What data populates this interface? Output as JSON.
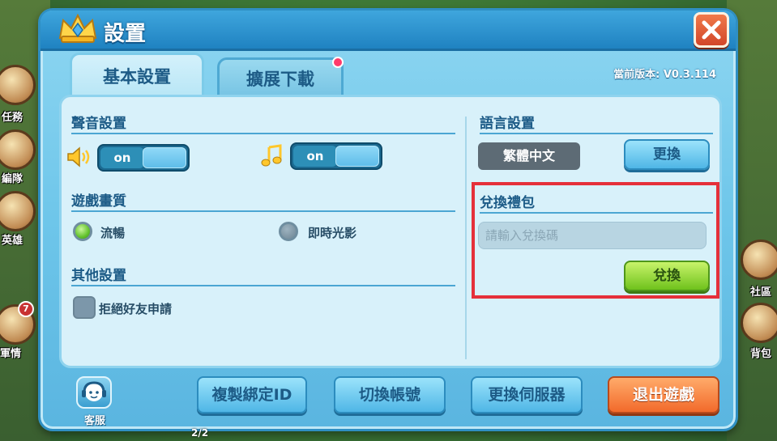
{
  "dialog": {
    "title": "設置",
    "tabs": [
      {
        "label": "基本設置",
        "active": true
      },
      {
        "label": "擴展下載",
        "active": false,
        "has_notification": true
      }
    ],
    "version_label": "當前版本: V0.3.114"
  },
  "sound": {
    "title": "聲音設置",
    "sound_effects": {
      "icon": "speaker-icon",
      "toggle_label": "on"
    },
    "music": {
      "icon": "music-note-icon",
      "toggle_label": "on"
    }
  },
  "quality": {
    "title": "遊戲畫質",
    "options": [
      {
        "label": "流暢",
        "selected": true
      },
      {
        "label": "即時光影",
        "selected": false
      }
    ]
  },
  "other": {
    "title": "其他設置",
    "reject_friend_label": "拒絕好友申請"
  },
  "language": {
    "title": "語言設置",
    "current": "繁體中文",
    "change_button": "更換"
  },
  "gift": {
    "title": "兌換禮包",
    "placeholder": "請輸入兌換碼",
    "redeem_button": "兌換"
  },
  "footer": {
    "support_label": "客服",
    "buttons": [
      "複製綁定ID",
      "切換帳號",
      "更換伺服器",
      "退出遊戲"
    ],
    "page_indicator": "2/2"
  },
  "background": {
    "left_labels": [
      "任務",
      "編隊",
      "英雄",
      "軍情"
    ],
    "right_labels": [
      "社區",
      "背包"
    ],
    "badge_count": "7"
  },
  "colors": {
    "accent": "#2f8fc3",
    "highlight": "#e5303a",
    "green_button": "#6fc21c",
    "exit_button": "#f26a2b"
  }
}
